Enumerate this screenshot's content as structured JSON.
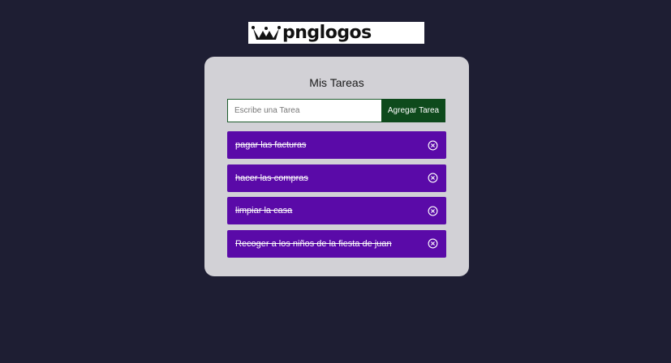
{
  "logo": {
    "text": "pnglogos"
  },
  "card": {
    "title": "Mis Tareas",
    "input_placeholder": "Escribe una Tarea",
    "input_value": "",
    "add_button_label": "Agregar Tarea"
  },
  "tasks": [
    {
      "label": "pagar las facturas",
      "completed": true,
      "icon": "close-circle-icon"
    },
    {
      "label": "hacer las compras",
      "completed": true,
      "icon": "close-circle-icon"
    },
    {
      "label": "limpiar la casa",
      "completed": true,
      "icon": "close-circle-icon"
    },
    {
      "label": "Recoger a los niños de la fiesta de juan",
      "completed": true,
      "icon": "close-circle-icon"
    }
  ],
  "colors": {
    "background": "#1e1e33",
    "card": "#d2d1d6",
    "task": "#5a0aa8",
    "button": "#0e4a1c"
  }
}
